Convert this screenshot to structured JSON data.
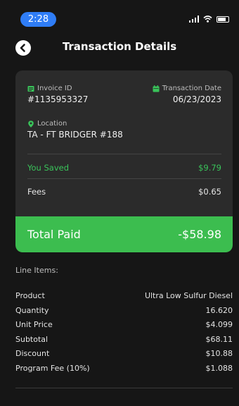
{
  "status_bar": {
    "time": "2:28"
  },
  "header": {
    "title": "Transaction Details"
  },
  "card": {
    "invoice": {
      "label": "Invoice ID",
      "value": "#1135953327"
    },
    "transaction_date": {
      "label": "Transaction Date",
      "value": "06/23/2023"
    },
    "location": {
      "label": "Location",
      "value": "TA - FT BRIDGER #188"
    },
    "you_saved": {
      "label": "You Saved",
      "value": "$9.79"
    },
    "fees": {
      "label": "Fees",
      "value": "$0.65"
    },
    "total_paid": {
      "label": "Total Paid",
      "value": "-$58.98"
    }
  },
  "line_items": {
    "heading": "Line Items:",
    "rows": [
      {
        "label": "Product",
        "value": "Ultra Low Sulfur Diesel"
      },
      {
        "label": "Quantity",
        "value": "16.620"
      },
      {
        "label": "Unit Price",
        "value": "$4.099"
      },
      {
        "label": "Subtotal",
        "value": "$68.11"
      },
      {
        "label": "Discount",
        "value": "$10.88"
      },
      {
        "label": "Program Fee (10%)",
        "value": "$1.088"
      }
    ]
  },
  "colors": {
    "accent_green": "#3cbd4f",
    "saved_green": "#39c45a",
    "status_pill": "#2f7df6"
  },
  "icons": [
    "back-arrow-icon",
    "invoice-icon",
    "calendar-icon",
    "location-pin-icon",
    "signal-icon",
    "wifi-icon",
    "battery-icon"
  ]
}
